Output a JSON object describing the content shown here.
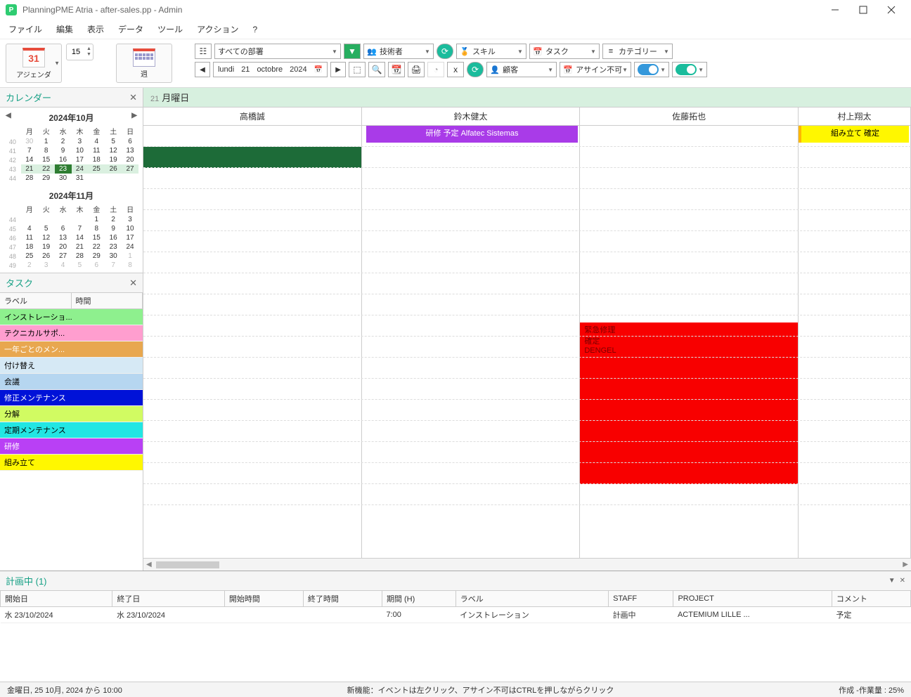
{
  "title": "PlanningPME Atria - after-sales.pp - Admin",
  "menu": {
    "file": "ファイル",
    "edit": "編集",
    "view": "表示",
    "data": "データ",
    "tools": "ツール",
    "action": "アクション",
    "help": "?"
  },
  "toolbar": {
    "agenda_num": "31",
    "agenda_label": "アジェンダ",
    "spin": "15",
    "week_label": "週",
    "dept": "すべての部署",
    "tech": "技術者",
    "skill": "スキル",
    "task": "タスク",
    "category": "カテゴリー",
    "customer": "顧客",
    "unassigned": "アサイン不可",
    "date_day": "lundi",
    "date_d": "21",
    "date_m": "octobre",
    "date_y": "2024"
  },
  "calendar": {
    "title": "カレンダー",
    "m1": "2024年10月",
    "m2": "2024年11月",
    "dow": [
      "月",
      "火",
      "水",
      "木",
      "金",
      "土",
      "日"
    ],
    "oct_weeks": [
      {
        "wk": "40",
        "days": [
          "30",
          "1",
          "2",
          "3",
          "4",
          "5",
          "6"
        ],
        "dim": [
          0
        ]
      },
      {
        "wk": "41",
        "days": [
          "7",
          "8",
          "9",
          "10",
          "11",
          "12",
          "13"
        ]
      },
      {
        "wk": "42",
        "days": [
          "14",
          "15",
          "16",
          "17",
          "18",
          "19",
          "20"
        ]
      },
      {
        "wk": "43",
        "days": [
          "21",
          "22",
          "23",
          "24",
          "25",
          "26",
          "27"
        ],
        "sel": [
          0,
          1,
          3,
          4,
          5,
          6
        ],
        "today": 2
      },
      {
        "wk": "44",
        "days": [
          "28",
          "29",
          "30",
          "31",
          "",
          "",
          ""
        ]
      }
    ],
    "nov_weeks": [
      {
        "wk": "44",
        "days": [
          "",
          "",
          "",
          "",
          "1",
          "2",
          "3"
        ]
      },
      {
        "wk": "45",
        "days": [
          "4",
          "5",
          "6",
          "7",
          "8",
          "9",
          "10"
        ]
      },
      {
        "wk": "46",
        "days": [
          "11",
          "12",
          "13",
          "14",
          "15",
          "16",
          "17"
        ]
      },
      {
        "wk": "47",
        "days": [
          "18",
          "19",
          "20",
          "21",
          "22",
          "23",
          "24"
        ]
      },
      {
        "wk": "48",
        "days": [
          "25",
          "26",
          "27",
          "28",
          "29",
          "30",
          "1"
        ],
        "dim": [
          6
        ]
      },
      {
        "wk": "49",
        "days": [
          "2",
          "3",
          "4",
          "5",
          "6",
          "7",
          "8"
        ],
        "dim": [
          0,
          1,
          2,
          3,
          4,
          5,
          6
        ]
      }
    ]
  },
  "tasks": {
    "title": "タスク",
    "col1": "ラベル",
    "col2": "時間",
    "items": [
      "インストレーショ...",
      "テクニカルサポ...",
      "一年ごとのメン...",
      "付け替え",
      "会議",
      "修正メンテナンス",
      "分解",
      "定期メンテナンス",
      "研修",
      "組み立て"
    ]
  },
  "schedule": {
    "daynum": "21",
    "dayname": "月曜日",
    "cols": [
      "高橋誠",
      "鈴木健太",
      "佐藤拓也",
      "村上翔太"
    ],
    "evt_purple": "研修 予定 Alfatec Sistemas",
    "evt_yellow": "組み立て 確定",
    "evt_red_l1": "緊急修理",
    "evt_red_l2": "確定",
    "evt_red_l3": "DENGEL"
  },
  "bottom": {
    "title": "計画中 (1)",
    "cols": [
      "開始日",
      "終了日",
      "開始時間",
      "終了時間",
      "期間 (H)",
      "ラベル",
      "STAFF",
      "PROJECT",
      "コメント"
    ],
    "row": {
      "start": "水 23/10/2024",
      "end": "水 23/10/2024",
      "stime": "",
      "etime": "",
      "dur": "7:00",
      "label": "インストレーション",
      "staff": "計画中",
      "project": "ACTEMIUM LILLE ...",
      "comment": "予定"
    }
  },
  "status": {
    "left": "金曜日, 25 10月, 2024 から 10:00",
    "mid": "新機能：イベントは左クリック、アサイン不可はCTRLを押しながらクリック",
    "right": "作成 -作業量 : 25%"
  }
}
